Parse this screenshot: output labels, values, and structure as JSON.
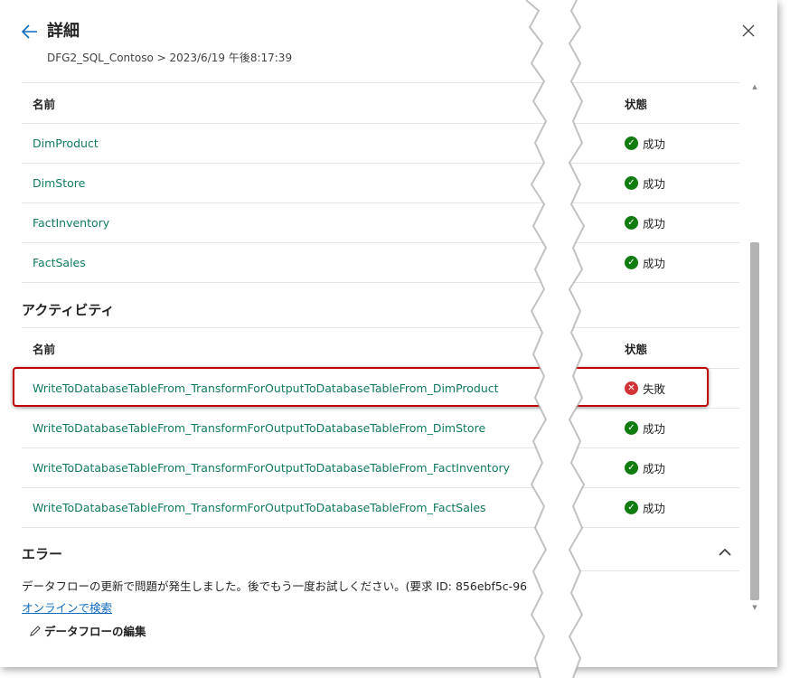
{
  "header": {
    "title": "詳細",
    "breadcrumb": "DFG2_SQL_Contoso > 2023/6/19 午後8:17:39"
  },
  "tables_section": {
    "col_name": "名前",
    "col_status": "状態",
    "rows": [
      {
        "name": "DimProduct",
        "status": "成功"
      },
      {
        "name": "DimStore",
        "status": "成功"
      },
      {
        "name": "FactInventory",
        "status": "成功"
      },
      {
        "name": "FactSales",
        "status": "成功"
      }
    ]
  },
  "activities": {
    "title": "アクティビティ",
    "col_name": "名前",
    "col_status": "状態",
    "rows": [
      {
        "name": "WriteToDatabaseTableFrom_TransformForOutputToDatabaseTableFrom_DimProduct",
        "status": "失敗"
      },
      {
        "name": "WriteToDatabaseTableFrom_TransformForOutputToDatabaseTableFrom_DimStore",
        "status": "成功"
      },
      {
        "name": "WriteToDatabaseTableFrom_TransformForOutputToDatabaseTableFrom_FactInventory",
        "status": "成功"
      },
      {
        "name": "WriteToDatabaseTableFrom_TransformForOutputToDatabaseTableFrom_FactSales",
        "status": "成功"
      }
    ]
  },
  "error": {
    "title": "エラー",
    "message": "データフローの更新で問題が発生しました。後でもう一度お試しください。(要求 ID: 856ebf5c-96",
    "search_link": "オンラインで検索",
    "edit_label": "データフローの編集"
  },
  "colors": {
    "link": "#0f7a62",
    "success": "#107c10",
    "failure": "#d13438",
    "highlight": "#c00000"
  }
}
